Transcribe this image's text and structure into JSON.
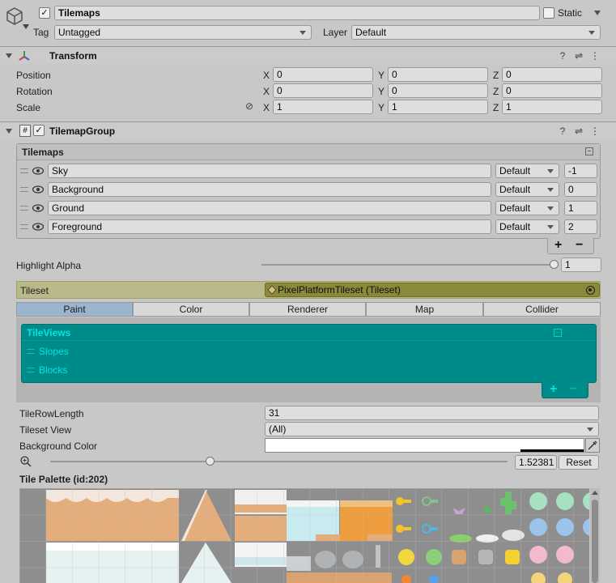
{
  "object": {
    "name": "Tilemaps",
    "static_label": "Static",
    "tag_label": "Tag",
    "tag_value": "Untagged",
    "layer_label": "Layer",
    "layer_value": "Default"
  },
  "transform": {
    "title": "Transform",
    "rows": [
      {
        "label": "Position",
        "x": "0",
        "y": "0",
        "z": "0"
      },
      {
        "label": "Rotation",
        "x": "0",
        "y": "0",
        "z": "0"
      },
      {
        "label": "Scale",
        "x": "1",
        "y": "1",
        "z": "1"
      }
    ],
    "axes": [
      "X",
      "Y",
      "Z"
    ]
  },
  "group": {
    "title": "TilemapGroup",
    "list_title": "Tilemaps",
    "items": [
      {
        "name": "Sky",
        "layer": "Default",
        "order": "-1"
      },
      {
        "name": "Background",
        "layer": "Default",
        "order": "0"
      },
      {
        "name": "Ground",
        "layer": "Default",
        "order": "1"
      },
      {
        "name": "Foreground",
        "layer": "Default",
        "order": "2"
      }
    ],
    "highlight_label": "Highlight Alpha",
    "highlight_value": "1",
    "highlight_level": 1.0
  },
  "tileset": {
    "label": "Tileset",
    "value": "PixelPlatformTileset (Tileset)"
  },
  "tabs": [
    "Paint",
    "Color",
    "Renderer",
    "Map",
    "Collider"
  ],
  "tileviews": {
    "title": "TileViews",
    "items": [
      "Slopes",
      "Blocks"
    ]
  },
  "settings": {
    "row_length_label": "TileRowLength",
    "row_length_value": "31",
    "view_label": "Tileset View",
    "view_value": "(All)",
    "bg_color_label": "Background Color",
    "zoom_value": "1.52381",
    "zoom_level": 0.35,
    "reset_label": "Reset"
  },
  "palette": {
    "title": "Tile Palette (id:202)"
  },
  "colors": {
    "teal": "#008b8b",
    "teal_text": "#00e5e5",
    "tileset_bg": "#8a8a3a",
    "tab_active": "#9bb5cf"
  }
}
